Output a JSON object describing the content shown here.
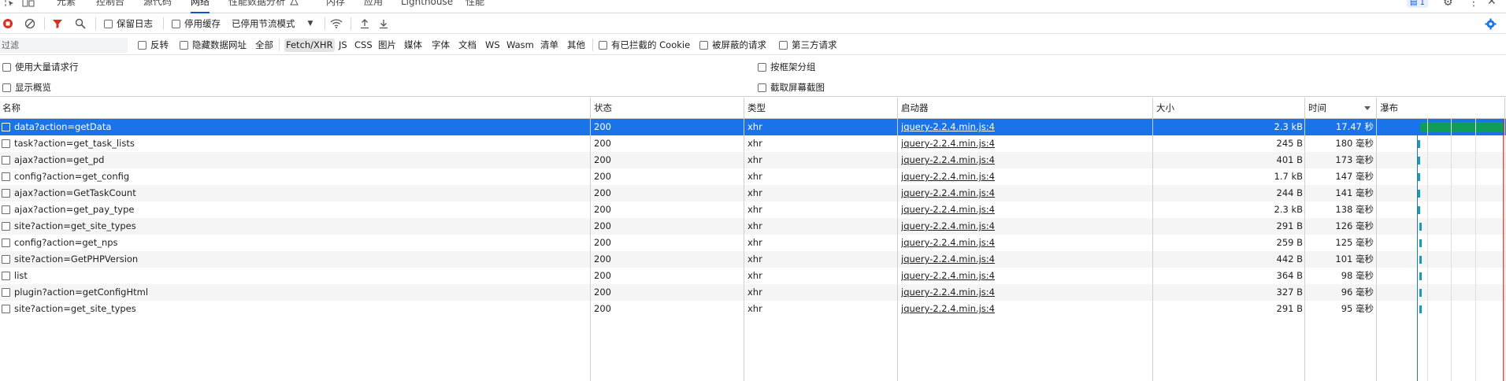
{
  "tabs": [
    "元素",
    "控制台",
    "源代码",
    "网络",
    "性能数据分析",
    "内存",
    "应用",
    "Lighthouse",
    "性能"
  ],
  "tabs_active": "网络",
  "badge_count": "1",
  "toolbar": {
    "preserve_log": "保留日志",
    "disable_cache": "停用缓存",
    "throttle": "已停用节流模式"
  },
  "filter": {
    "placeholder": "过滤",
    "invert": "反转",
    "hide_data_urls": "隐藏数据网址",
    "types": [
      "全部",
      "Fetch/XHR",
      "JS",
      "CSS",
      "图片",
      "媒体",
      "字体",
      "文档",
      "WS",
      "Wasm",
      "清单",
      "其他"
    ],
    "active_type": "Fetch/XHR",
    "blocked_cookies": "有已拦截的 Cookie",
    "blocked_requests": "被屏蔽的请求",
    "third_party": "第三方请求"
  },
  "options": {
    "large_rows": "使用大量请求行",
    "show_overview": "显示概览",
    "group_by_frame": "按框架分组",
    "capture_screenshots": "截取屏幕截图"
  },
  "columns": {
    "name": "名称",
    "status": "状态",
    "type": "类型",
    "initiator": "启动器",
    "size": "大小",
    "time": "时间",
    "waterfall": "瀑布"
  },
  "rows": [
    {
      "name": "data?action=getData",
      "status": "200",
      "type": "xhr",
      "initiator": "jquery-2.2.4.min.js:4",
      "size": "2.3 kB",
      "time": "17.47 秒",
      "selected": true
    },
    {
      "name": "task?action=get_task_lists",
      "status": "200",
      "type": "xhr",
      "initiator": "jquery-2.2.4.min.js:4",
      "size": "245 B",
      "time": "180 毫秒"
    },
    {
      "name": "ajax?action=get_pd",
      "status": "200",
      "type": "xhr",
      "initiator": "jquery-2.2.4.min.js:4",
      "size": "401 B",
      "time": "173 毫秒"
    },
    {
      "name": "config?action=get_config",
      "status": "200",
      "type": "xhr",
      "initiator": "jquery-2.2.4.min.js:4",
      "size": "1.7 kB",
      "time": "147 毫秒"
    },
    {
      "name": "ajax?action=GetTaskCount",
      "status": "200",
      "type": "xhr",
      "initiator": "jquery-2.2.4.min.js:4",
      "size": "244 B",
      "time": "141 毫秒"
    },
    {
      "name": "ajax?action=get_pay_type",
      "status": "200",
      "type": "xhr",
      "initiator": "jquery-2.2.4.min.js:4",
      "size": "2.3 kB",
      "time": "138 毫秒"
    },
    {
      "name": "site?action=get_site_types",
      "status": "200",
      "type": "xhr",
      "initiator": "jquery-2.2.4.min.js:4",
      "size": "291 B",
      "time": "126 毫秒"
    },
    {
      "name": "config?action=get_nps",
      "status": "200",
      "type": "xhr",
      "initiator": "jquery-2.2.4.min.js:4",
      "size": "259 B",
      "time": "125 毫秒"
    },
    {
      "name": "site?action=GetPHPVersion",
      "status": "200",
      "type": "xhr",
      "initiator": "jquery-2.2.4.min.js:4",
      "size": "442 B",
      "time": "101 毫秒"
    },
    {
      "name": "list",
      "status": "200",
      "type": "xhr",
      "initiator": "jquery-2.2.4.min.js:4",
      "size": "364 B",
      "time": "98 毫秒"
    },
    {
      "name": "plugin?action=getConfigHtml",
      "status": "200",
      "type": "xhr",
      "initiator": "jquery-2.2.4.min.js:4",
      "size": "327 B",
      "time": "96 毫秒"
    },
    {
      "name": "site?action=get_site_types",
      "status": "200",
      "type": "xhr",
      "initiator": "jquery-2.2.4.min.js:4",
      "size": "291 B",
      "time": "95 毫秒"
    }
  ],
  "colors": {
    "accent": "#1a73e8",
    "record_red": "#d93025",
    "waterfall_teal": "#1a9ab3",
    "waterfall_green": "#0f9d58"
  }
}
